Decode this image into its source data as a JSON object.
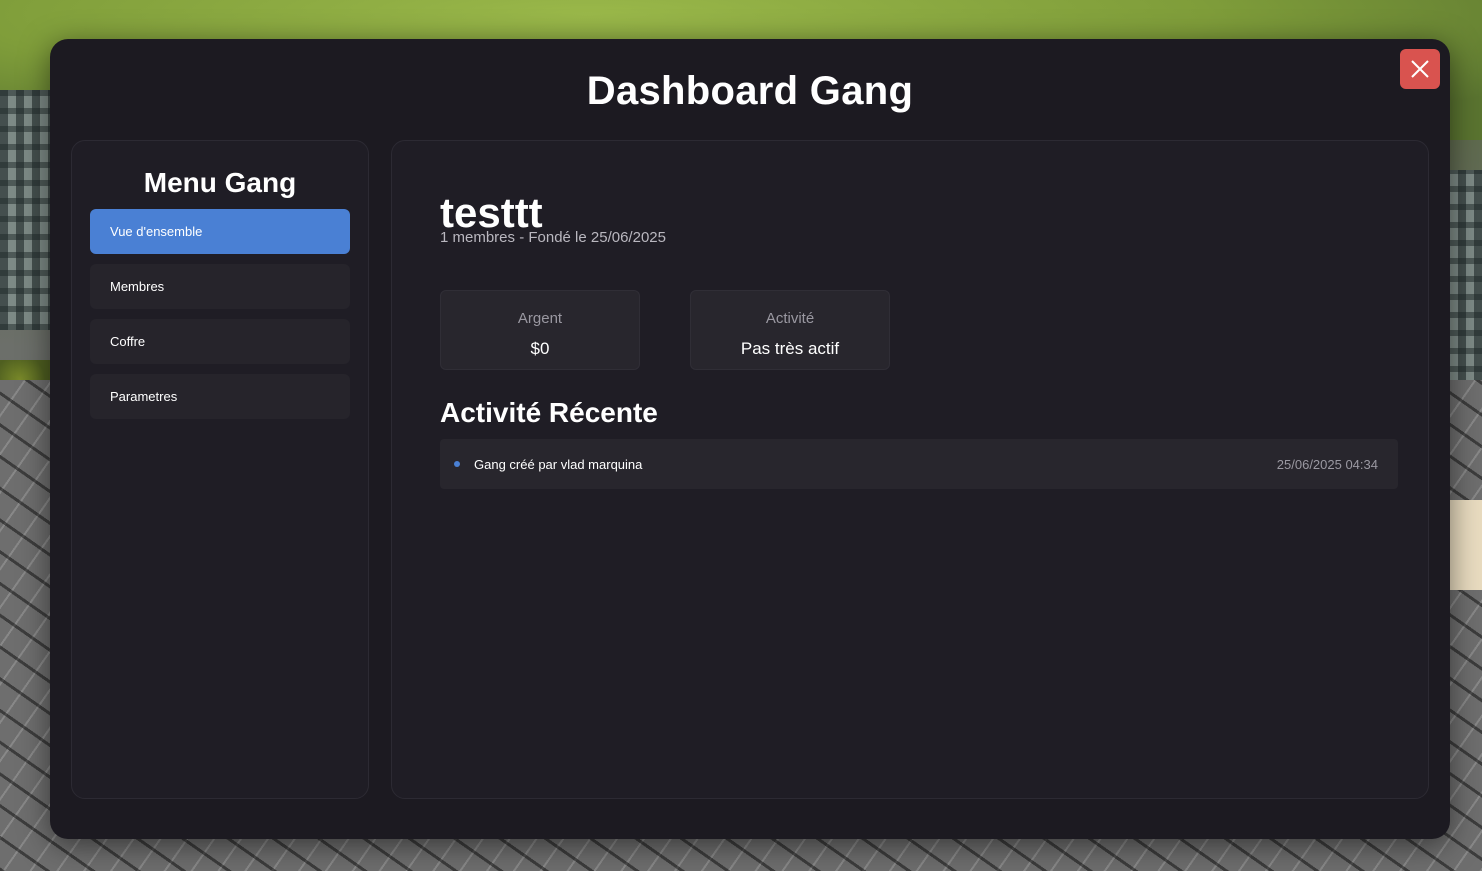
{
  "window": {
    "title": "Dashboard Gang",
    "close_icon": "close-icon"
  },
  "sidebar": {
    "title": "Menu Gang",
    "items": [
      {
        "label": "Vue d'ensemble",
        "active": true
      },
      {
        "label": "Membres",
        "active": false
      },
      {
        "label": "Coffre",
        "active": false
      },
      {
        "label": "Parametres",
        "active": false
      }
    ]
  },
  "overview": {
    "gang_name": "testtt",
    "meta": "1 membres - Fondé le 25/06/2025",
    "stats": [
      {
        "label": "Argent",
        "value": "$0"
      },
      {
        "label": "Activité",
        "value": "Pas très actif"
      }
    ],
    "recent_title": "Activité Récente",
    "activities": [
      {
        "text": "Gang créé par vlad marquina",
        "time": "25/06/2025 04:34"
      }
    ]
  },
  "colors": {
    "accent": "#4a80d4",
    "close": "#d9534f",
    "panel_bg": "#1c1a21"
  }
}
